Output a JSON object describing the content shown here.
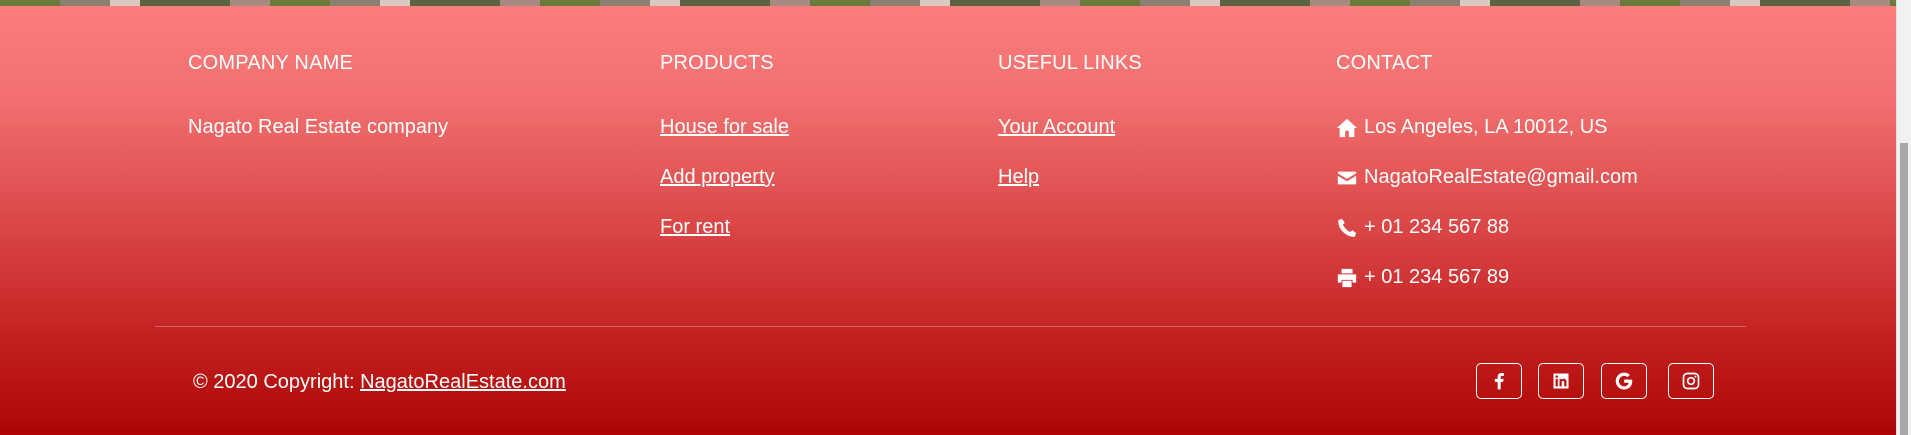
{
  "footer": {
    "company": {
      "heading": "COMPANY NAME",
      "text": "Nagato Real Estate company"
    },
    "products": {
      "heading": "PRODUCTS",
      "links": [
        "House for sale",
        "Add property",
        "For rent"
      ]
    },
    "useful_links": {
      "heading": "USEFUL LINKS",
      "links": [
        "Your Account",
        "Help"
      ]
    },
    "contact": {
      "heading": "CONTACT",
      "address": "Los Angeles, LA 10012, US",
      "email": "NagatoRealEstate@gmail.com",
      "phone": "+ 01 234 567 88",
      "fax": "+ 01 234 567 89"
    },
    "copyright": {
      "prefix": "© 2020 Copyright: ",
      "link": "NagatoRealEstate.com"
    },
    "social": [
      "facebook-icon",
      "linkedin-icon",
      "google-icon",
      "instagram-icon"
    ],
    "colors": {
      "gradient_top": "#fb7d7d",
      "gradient_bottom": "#ad0505",
      "text": "#ffffff"
    }
  }
}
